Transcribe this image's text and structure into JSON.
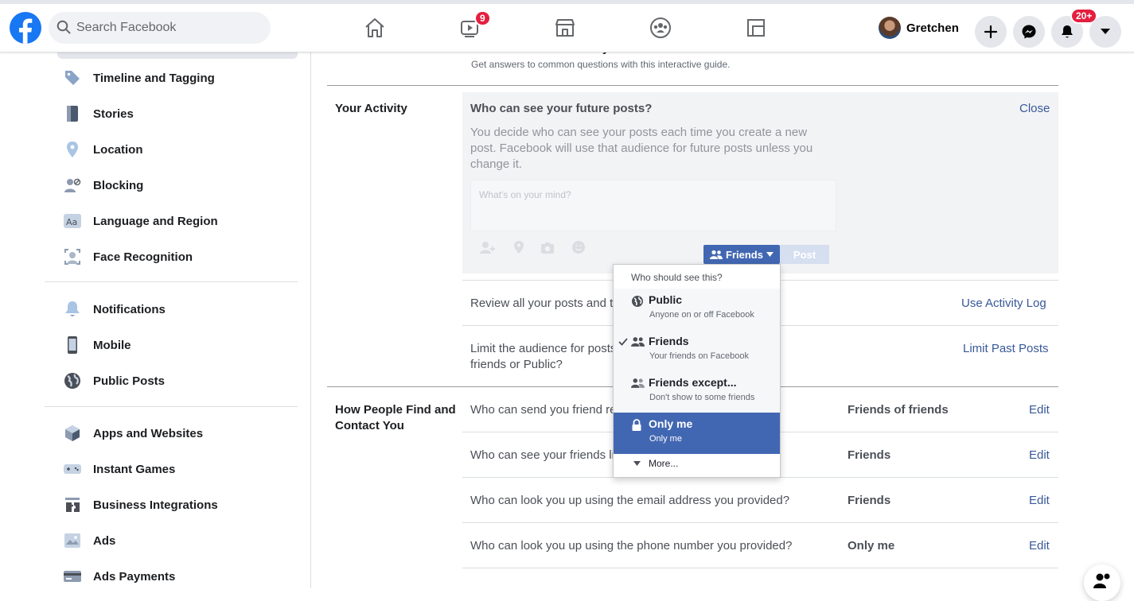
{
  "header": {
    "search_placeholder": "Search Facebook",
    "watch_badge": "9",
    "notifications_badge": "20+",
    "profile_name": "Gretchen"
  },
  "sidebar": {
    "items": [
      {
        "label": "Timeline and Tagging",
        "icon": "tag-icon"
      },
      {
        "label": "Stories",
        "icon": "book-icon"
      },
      {
        "label": "Location",
        "icon": "location-pin-icon"
      },
      {
        "label": "Blocking",
        "icon": "blocked-user-icon"
      },
      {
        "label": "Language and Region",
        "icon": "language-icon"
      },
      {
        "label": "Face Recognition",
        "icon": "face-recognition-icon"
      },
      {
        "label": "Notifications",
        "icon": "bell-icon"
      },
      {
        "label": "Mobile",
        "icon": "phone-icon"
      },
      {
        "label": "Public Posts",
        "icon": "globe-icon"
      },
      {
        "label": "Apps and Websites",
        "icon": "cube-icon"
      },
      {
        "label": "Instant Games",
        "icon": "gamepad-icon"
      },
      {
        "label": "Business Integrations",
        "icon": "puzzle-icon"
      },
      {
        "label": "Ads",
        "icon": "ads-icon"
      },
      {
        "label": "Ads Payments",
        "icon": "credit-card-icon"
      }
    ]
  },
  "main": {
    "privacy_basics_partial": "Learn more with Privacy Basics",
    "privacy_basics_sub": "Get answers to common questions with this interactive guide.",
    "your_activity": {
      "section_title": "Your Activity",
      "future_posts_title": "Who can see your future posts?",
      "close": "Close",
      "description": [
        "You decide who can see your posts each time you create a new",
        "post. Facebook will use that audience for future posts unless you",
        "change it."
      ],
      "composer_placeholder": "What's on your mind?",
      "audience_button": "Friends",
      "post_button": "Post",
      "review_text": "Review all your posts and th",
      "review_action": "Use Activity Log",
      "limit_text_1": "Limit the audience for posts",
      "limit_text_2": "friends or Public?",
      "limit_action": "Limit Past Posts"
    },
    "find_contact": {
      "section_title_1": "How People Find and",
      "section_title_2": "Contact You",
      "rows": [
        {
          "question": "Who can send you friend re",
          "value": "Friends of friends",
          "action": "Edit"
        },
        {
          "question": "Who can see your friends li",
          "value": "Friends",
          "action": "Edit"
        },
        {
          "question": "Who can look you up using the email address you provided?",
          "value": "Friends",
          "action": "Edit"
        },
        {
          "question": "Who can look you up using the phone number you provided?",
          "value": "Only me",
          "action": "Edit"
        }
      ]
    }
  },
  "audience_dropdown": {
    "header": "Who should see this?",
    "options": [
      {
        "title": "Public",
        "subtitle": "Anyone on or off Facebook",
        "icon": "globe-icon",
        "checked": false,
        "selected": false
      },
      {
        "title": "Friends",
        "subtitle": "Your friends on Facebook",
        "icon": "friends-icon",
        "checked": true,
        "selected": false
      },
      {
        "title": "Friends except...",
        "subtitle": "Don't show to some friends",
        "icon": "friends-except-icon",
        "checked": false,
        "selected": false
      },
      {
        "title": "Only me",
        "subtitle": "Only me",
        "icon": "lock-icon",
        "checked": false,
        "selected": true
      }
    ],
    "more": "More..."
  },
  "colors": {
    "brand_blue": "#1877f2",
    "link_blue": "#385898",
    "button_blue": "#4267b2",
    "badge_red": "#e41e3f"
  }
}
